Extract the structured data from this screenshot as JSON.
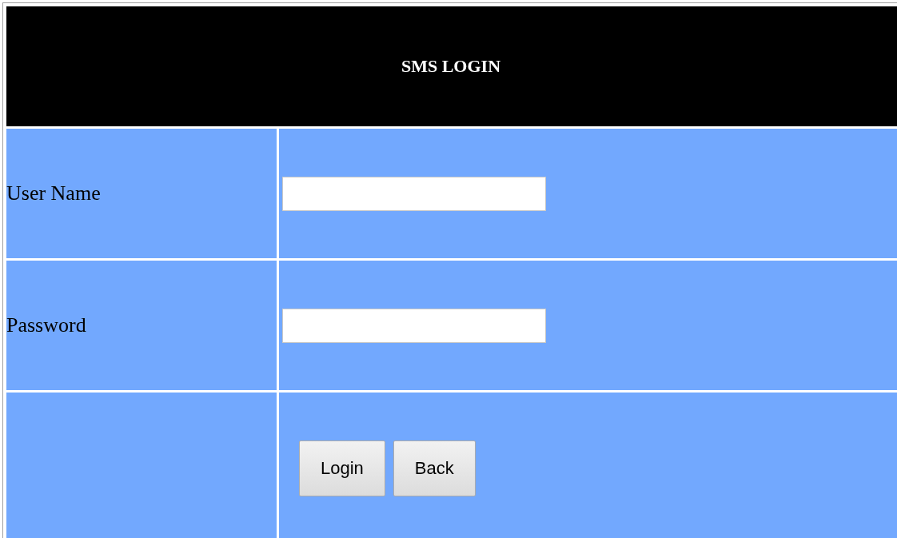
{
  "header": {
    "title": "SMS LOGIN"
  },
  "fields": [
    {
      "label": "User Name"
    },
    {
      "label": "Password"
    }
  ],
  "buttons": [
    "Login",
    "Back"
  ]
}
